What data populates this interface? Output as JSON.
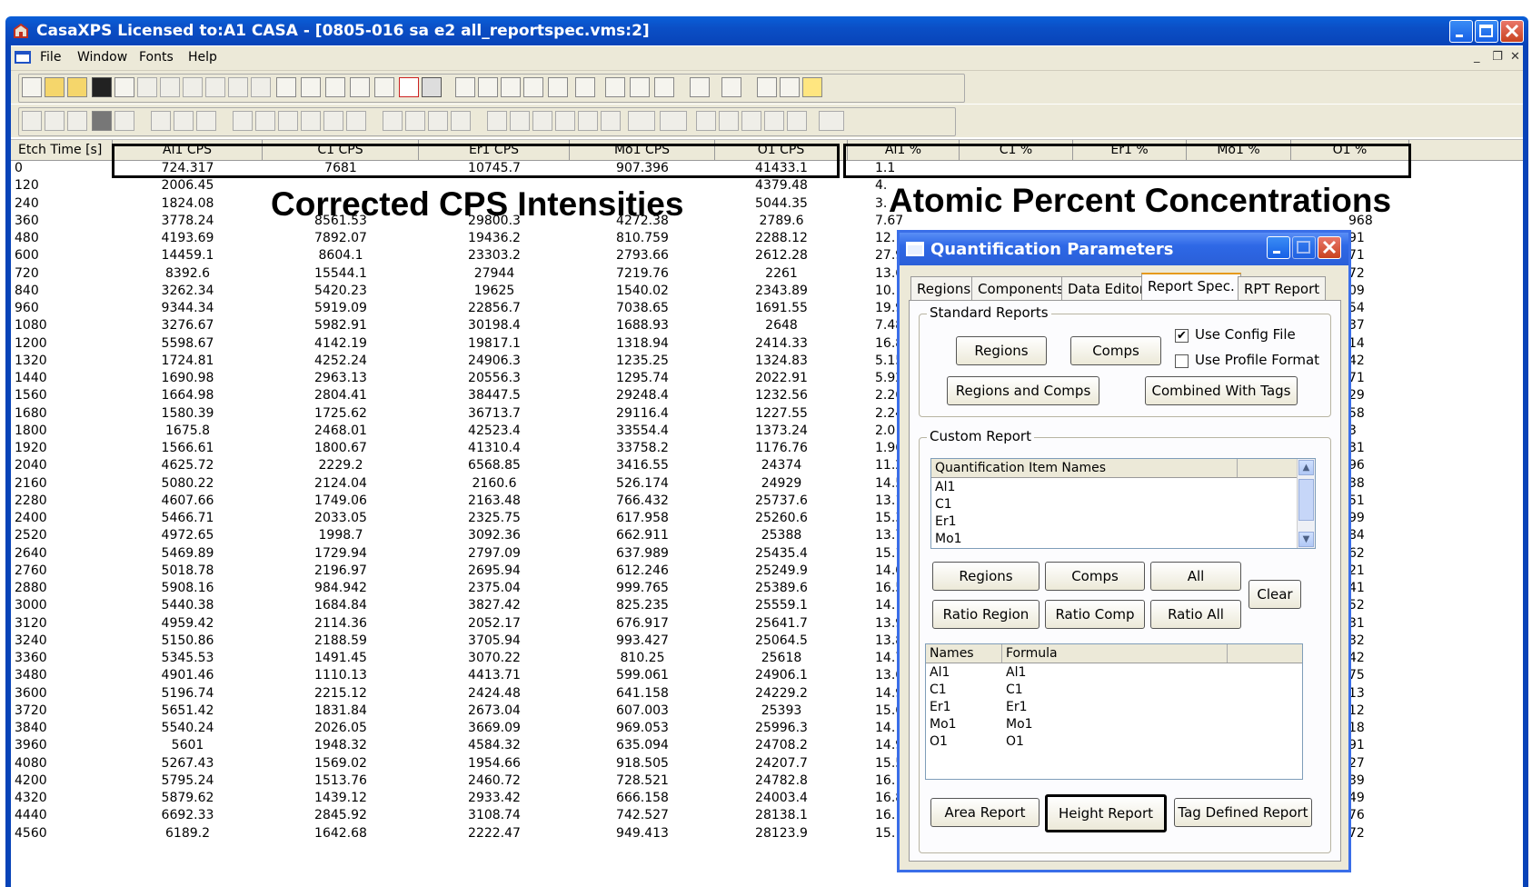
{
  "window": {
    "title": "CasaXPS Licensed to:A1 CASA - [0805-016 sa e2 all_reportspec.vms:2]"
  },
  "menu": [
    "File",
    "Window",
    "Fonts",
    "Help"
  ],
  "mdi_controls": [
    "_",
    " ❐",
    "✕"
  ],
  "columns": {
    "etch": "Etch Time [s]",
    "cps": [
      "Al1 CPS",
      "C1 CPS",
      "Er1 CPS",
      "Mo1 CPS",
      "O1 CPS"
    ],
    "pct": [
      "Al1 %",
      "C1 %",
      "Er1 %",
      "Mo1 %",
      "O1 %"
    ]
  },
  "overlays": {
    "cps": "Corrected CPS Intensities",
    "pct": "Atomic Percent Concentrations"
  },
  "rows": [
    [
      "0",
      "724.317",
      "7681",
      "10745.7",
      "907.396",
      "41433.1",
      "1.1"
    ],
    [
      "120",
      "2006.45",
      "",
      "",
      "",
      "4379.48",
      "4."
    ],
    [
      "240",
      "1824.08",
      "",
      "",
      "",
      "5044.35",
      "3."
    ],
    [
      "360",
      "3778.24",
      "8561.53",
      "29800.3",
      "4272.38",
      "2789.6",
      "7.67"
    ],
    [
      "480",
      "4193.69",
      "7892.07",
      "19436.2",
      "810.759",
      "2288.12",
      "12."
    ],
    [
      "600",
      "14459.1",
      "8604.1",
      "23303.2",
      "2793.66",
      "2612.28",
      "27.9"
    ],
    [
      "720",
      "8392.6",
      "15544.1",
      "27944",
      "7219.76",
      "2261",
      "13.6"
    ],
    [
      "840",
      "3262.34",
      "5420.23",
      "19625",
      "1540.02",
      "2343.89",
      "10."
    ],
    [
      "960",
      "9344.34",
      "5919.09",
      "22856.7",
      "7038.65",
      "1691.55",
      "19.9"
    ],
    [
      "1080",
      "3276.67",
      "5982.91",
      "30198.4",
      "1688.93",
      "2648",
      "7.48"
    ],
    [
      "1200",
      "5598.67",
      "4142.19",
      "19817.1",
      "1318.94",
      "2414.33",
      "16.8"
    ],
    [
      "1320",
      "1724.81",
      "4252.24",
      "24906.3",
      "1235.25",
      "1324.83",
      "5.15"
    ],
    [
      "1440",
      "1690.98",
      "2963.13",
      "20556.3",
      "1295.74",
      "2022.91",
      "5.92"
    ],
    [
      "1560",
      "1664.98",
      "2804.41",
      "38447.5",
      "29248.4",
      "1232.56",
      "2.26"
    ],
    [
      "1680",
      "1580.39",
      "1725.62",
      "36713.7",
      "29116.4",
      "1227.55",
      "2.24"
    ],
    [
      "1800",
      "1675.8",
      "2468.01",
      "42523.4",
      "33554.4",
      "1373.24",
      "2.0"
    ],
    [
      "1920",
      "1566.61",
      "1800.67",
      "41310.4",
      "33758.2",
      "1176.76",
      "1.96"
    ],
    [
      "2040",
      "4625.72",
      "2229.2",
      "6568.85",
      "3416.55",
      "24374",
      "11.2"
    ],
    [
      "2160",
      "5080.22",
      "2124.04",
      "2160.6",
      "526.174",
      "24929",
      "14.5"
    ],
    [
      "2280",
      "4607.66",
      "1749.06",
      "2163.48",
      "766.432",
      "25737.6",
      "13.1"
    ],
    [
      "2400",
      "5466.71",
      "2033.05",
      "2325.75",
      "617.958",
      "25260.6",
      "15.3"
    ],
    [
      "2520",
      "4972.65",
      "1998.7",
      "3092.36",
      "662.911",
      "25388",
      "13.7"
    ],
    [
      "2640",
      "5469.89",
      "1729.94",
      "2797.09",
      "637.989",
      "25435.4",
      "15.1"
    ],
    [
      "2760",
      "5018.78",
      "2196.97",
      "2695.94",
      "612.246",
      "25249.9",
      "14.0"
    ],
    [
      "2880",
      "5908.16",
      "984.942",
      "2375.04",
      "999.765",
      "25389.6",
      "16.5"
    ],
    [
      "3000",
      "5440.38",
      "1684.84",
      "3827.42",
      "825.235",
      "25559.1",
      "14."
    ],
    [
      "3120",
      "4959.42",
      "2114.36",
      "2052.17",
      "676.917",
      "25641.7",
      "13.9"
    ],
    [
      "3240",
      "5150.86",
      "2188.59",
      "3705.94",
      "993.427",
      "25064.5",
      "13.8"
    ],
    [
      "3360",
      "5345.53",
      "1491.45",
      "3070.22",
      "810.25",
      "25618",
      "14.7"
    ],
    [
      "3480",
      "4901.46",
      "1110.13",
      "4413.71",
      "599.061",
      "24906.1",
      "13.6"
    ],
    [
      "3600",
      "5196.74",
      "2215.12",
      "2424.48",
      "641.158",
      "24229.2",
      "14.9"
    ],
    [
      "3720",
      "5651.42",
      "1831.84",
      "2673.04",
      "607.003",
      "25393",
      "15.6"
    ],
    [
      "3840",
      "5540.24",
      "2026.05",
      "3669.09",
      "969.053",
      "25996.3",
      "14."
    ],
    [
      "3960",
      "5601",
      "1948.32",
      "4584.32",
      "635.094",
      "24708.2",
      "14.9"
    ],
    [
      "4080",
      "5267.43",
      "1569.02",
      "1954.66",
      "918.505",
      "24207.7",
      "15.5"
    ],
    [
      "4200",
      "5795.24",
      "1513.76",
      "2460.72",
      "728.521",
      "24782.8",
      "16."
    ],
    [
      "4320",
      "5879.62",
      "1439.12",
      "2933.42",
      "666.158",
      "24003.4",
      "16.8"
    ],
    [
      "4440",
      "6692.33",
      "2845.92",
      "3108.74",
      "742.527",
      "28138.1",
      "16."
    ],
    [
      "4560",
      "6189.2",
      "1642.68",
      "2222.47",
      "949.413",
      "28123.9",
      "15."
    ]
  ],
  "right_edge_values": [
    "",
    "",
    "",
    "968",
    "91",
    "71",
    "72",
    "09",
    "54",
    "37",
    "14",
    "42",
    "71",
    "29",
    "58",
    "3",
    "31",
    "96",
    "38",
    "51",
    "99",
    "84",
    "62",
    "21",
    "41",
    "52",
    "31",
    "32",
    "42",
    "75",
    "13",
    "12",
    "18",
    "91",
    "27",
    "39",
    "49",
    "76",
    "72"
  ],
  "dialog": {
    "title": "Quantification Parameters",
    "tabs": [
      "Regions",
      "Components",
      "Data Editor",
      "Report Spec.",
      "RPT Report"
    ],
    "standard_reports": {
      "label": "Standard Reports",
      "use_config_file": "Use Config File",
      "use_config_checked": "✔",
      "use_profile_format": "Use Profile Format",
      "buttons": [
        "Regions",
        "Comps",
        "Regions and Comps",
        "Combined With Tags"
      ]
    },
    "custom_report": {
      "label": "Custom Report",
      "list_header": "Quantification Item Names",
      "items": [
        "Al1",
        "C1",
        "Er1",
        "Mo1"
      ],
      "buttons": [
        "Regions",
        "Comps",
        "All",
        "Clear",
        "Ratio Region",
        "Ratio Comp",
        "Ratio All"
      ],
      "formula_headers": [
        "Names",
        "Formula"
      ],
      "formulas": [
        [
          "Al1",
          "Al1"
        ],
        [
          "C1",
          "C1"
        ],
        [
          "Er1",
          "Er1"
        ],
        [
          "Mo1",
          "Mo1"
        ],
        [
          "O1",
          "O1"
        ]
      ],
      "report_buttons": [
        "Area Report",
        "Height Report",
        "Tag Defined Report"
      ]
    }
  }
}
